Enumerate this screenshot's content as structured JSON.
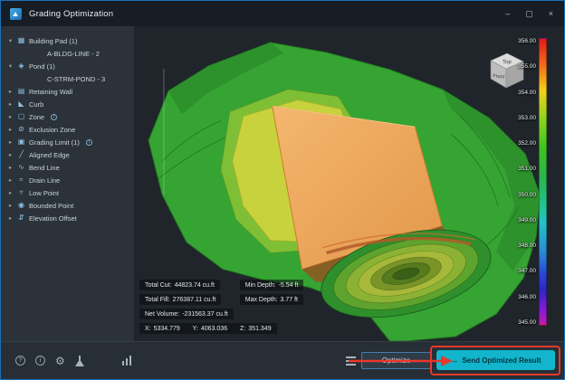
{
  "window": {
    "title": "Grading Optimization",
    "controls": {
      "minimize": "–",
      "maximize": "▢",
      "close": "×"
    }
  },
  "sidebar": {
    "items": [
      {
        "label": "Building Pad (1)",
        "level": 0,
        "expander": "down",
        "icon": "building-pad-icon"
      },
      {
        "label": "A-BLDG-LINE - 2",
        "level": 1,
        "expander": null,
        "icon": null
      },
      {
        "label": "Pond (1)",
        "level": 0,
        "expander": "down",
        "icon": "pond-icon"
      },
      {
        "label": "C-STRM-POND - 3",
        "level": 1,
        "expander": null,
        "icon": null
      },
      {
        "label": "Retaining Wall",
        "level": 0,
        "expander": "right",
        "icon": "retaining-wall-icon"
      },
      {
        "label": "Curb",
        "level": 0,
        "expander": "right",
        "icon": "curb-icon"
      },
      {
        "label": "Zone",
        "level": 0,
        "expander": "right",
        "icon": "zone-icon",
        "info": true
      },
      {
        "label": "Exclusion Zone",
        "level": 0,
        "expander": "right",
        "icon": "exclusion-zone-icon"
      },
      {
        "label": "Grading Limit (1)",
        "level": 0,
        "expander": "right",
        "icon": "grading-limit-icon",
        "info": true
      },
      {
        "label": "Aligned Edge",
        "level": 0,
        "expander": "right",
        "icon": "aligned-edge-icon"
      },
      {
        "label": "Bend Line",
        "level": 0,
        "expander": "right",
        "icon": "bend-line-icon"
      },
      {
        "label": "Drain Line",
        "level": 0,
        "expander": "right",
        "icon": "drain-line-icon"
      },
      {
        "label": "Low Point",
        "level": 0,
        "expander": "right",
        "icon": "low-point-icon"
      },
      {
        "label": "Bounded Point",
        "level": 0,
        "expander": "right",
        "icon": "bounded-point-icon"
      },
      {
        "label": "Elevation Offset",
        "level": 0,
        "expander": "right",
        "icon": "elevation-offset-icon"
      }
    ]
  },
  "viewport": {
    "viewcube": {
      "top_label": "Top",
      "front_label": "Front"
    },
    "legend": {
      "ticks": [
        "356.00",
        "355.00",
        "354.00",
        "353.00",
        "352.00",
        "351.00",
        "350.00",
        "349.00",
        "348.00",
        "347.00",
        "346.00",
        "345.00"
      ]
    },
    "stats": {
      "total_cut_label": "Total Cut:",
      "total_cut_value": "44823.74 cu.ft",
      "total_fill_label": "Total Fill:",
      "total_fill_value": "276387.11 cu.ft",
      "net_volume_label": "Net Volume:",
      "net_volume_value": "-231563.37 cu.ft",
      "min_depth_label": "Min Depth:",
      "min_depth_value": "-5.54 ft",
      "max_depth_label": "Max Depth:",
      "max_depth_value": "3.77 ft",
      "coord_x_label": "X:",
      "coord_x": "5334.779",
      "coord_y_label": "Y:",
      "coord_y": "4063.036",
      "coord_z_label": "Z:",
      "coord_z": "351.349"
    }
  },
  "footer": {
    "optimize_label": "Optimize",
    "send_icon": "→",
    "send_label": "Send Optimized Result"
  },
  "colors": {
    "accent_cyan": "#12b5cb",
    "annotation_red": "#e8392b",
    "terrain_green": "#36a433",
    "pad_orange": "#eaa65c"
  }
}
